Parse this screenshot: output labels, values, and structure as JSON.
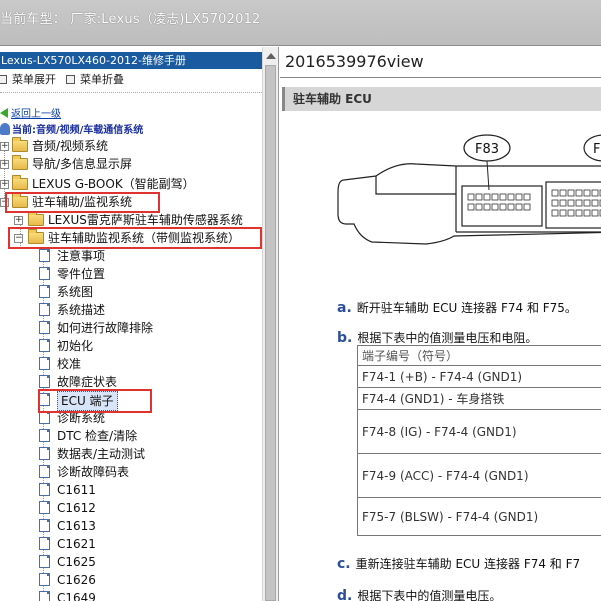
{
  "window": {
    "title": "当前车型： 厂家:Lexus（凌志)LX5702012"
  },
  "sidebar": {
    "header": "Lexus-LX570LX460-2012-维修手册",
    "toolbar": {
      "expand_label": "菜单展开",
      "collapse_label": "菜单折叠"
    },
    "back_label": "返回上一级",
    "current_label": "当前:音频/视频/车载通信系统",
    "tree": [
      {
        "label": "音频/视频系统"
      },
      {
        "label": "导航/多信息显示屏"
      },
      {
        "label": "LEXUS G-BOOK（智能副驾）"
      },
      {
        "label": "驻车辅助/监视系统"
      },
      {
        "label": "LEXUS雷克萨斯驻车辅助传感器系统"
      },
      {
        "label": "驻车辅助监视系统（带侧监视系统）"
      }
    ],
    "pages": [
      "注意事项",
      "零件位置",
      "系统图",
      "系统描述",
      "如何进行故障排除",
      "初始化",
      "校准",
      "故障症状表",
      "ECU 端子",
      "诊断系统",
      "DTC 检查/清除",
      "数据表/主动测试",
      "诊断故障码表",
      "C1611",
      "C1612",
      "C1613",
      "C1621",
      "C1625",
      "C1626",
      "C1649"
    ]
  },
  "content": {
    "view_title": "2016539976view",
    "section_title": "驻车辅助 ECU",
    "connector_labels": [
      "F83",
      "F"
    ],
    "step_a": {
      "marker": "a.",
      "text": "断开驻车辅助 ECU 连接器 F74 和 F75。"
    },
    "step_b": {
      "marker": "b.",
      "text": "根据下表中的值测量电压和电阻。"
    },
    "table_header": "端子编号（符号）",
    "table_rows": [
      "F74-1 (+B) - F74-4 (GND1)",
      "F74-4 (GND1) - 车身搭铁",
      "F74-8 (IG) - F74-4 (GND1)",
      "F74-9 (ACC) - F74-4 (GND1)",
      "F75-7 (BLSW) - F74-4 (GND1)"
    ],
    "step_c": {
      "marker": "c.",
      "text": "重新连接驻车辅助 ECU 连接器 F74 和 F7"
    },
    "step_d": {
      "marker": "d.",
      "text": "根据下表中的值测量电压。"
    }
  },
  "colors": {
    "header_blue": "#1a5a9e",
    "highlight_red": "#e0322e",
    "step_marker": "#2c4e9a"
  }
}
